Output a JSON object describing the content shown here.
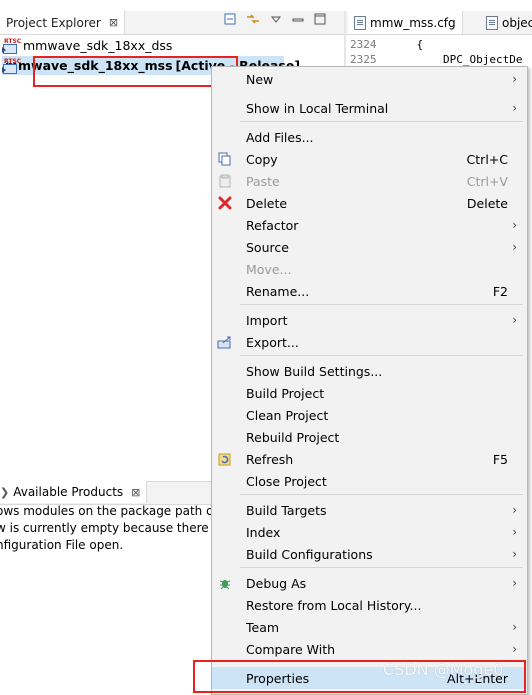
{
  "project_explorer": {
    "tab_title": "Project Explorer",
    "tree": [
      {
        "name": "mmwave_sdk_18xx_dss",
        "suffix": ""
      },
      {
        "name": "mmwave_sdk_18xx_mss",
        "suffix": "[Active - Release]"
      }
    ]
  },
  "editor": {
    "tabs": [
      "mmw_mss.cfg",
      "objec"
    ],
    "lines": [
      {
        "number": "2324",
        "text": "    {"
      },
      {
        "number": "2325",
        "text": "        DPC_ObjectDe"
      }
    ]
  },
  "available_products": {
    "tab_title": "Available Products",
    "text_lines": [
      "ows modules on the package path o",
      "w is currently empty because there is",
      "nfiguration File open."
    ]
  },
  "context_menu": {
    "groups": [
      [
        {
          "label": "New",
          "key": "",
          "submenu": true,
          "icon": "",
          "disabled": false
        },
        {
          "label": "Show in Local Terminal",
          "key": "",
          "submenu": true,
          "icon": "",
          "disabled": false
        }
      ],
      [
        {
          "label": "Add Files...",
          "key": "",
          "submenu": false,
          "icon": "",
          "disabled": false
        },
        {
          "label": "Copy",
          "key": "Ctrl+C",
          "submenu": false,
          "icon": "copy-icon",
          "disabled": false
        },
        {
          "label": "Paste",
          "key": "Ctrl+V",
          "submenu": false,
          "icon": "paste-icon",
          "disabled": true
        },
        {
          "label": "Delete",
          "key": "Delete",
          "submenu": false,
          "icon": "delete-icon",
          "disabled": false
        },
        {
          "label": "Refactor",
          "key": "",
          "submenu": true,
          "icon": "",
          "disabled": false
        },
        {
          "label": "Source",
          "key": "",
          "submenu": true,
          "icon": "",
          "disabled": false
        },
        {
          "label": "Move...",
          "key": "",
          "submenu": false,
          "icon": "",
          "disabled": true
        },
        {
          "label": "Rename...",
          "key": "F2",
          "submenu": false,
          "icon": "",
          "disabled": false
        }
      ],
      [
        {
          "label": "Import",
          "key": "",
          "submenu": true,
          "icon": "",
          "disabled": false
        },
        {
          "label": "Export...",
          "key": "",
          "submenu": false,
          "icon": "export-icon",
          "disabled": false
        }
      ],
      [
        {
          "label": "Show Build Settings...",
          "key": "",
          "submenu": false,
          "icon": "",
          "disabled": false
        },
        {
          "label": "Build Project",
          "key": "",
          "submenu": false,
          "icon": "",
          "disabled": false
        },
        {
          "label": "Clean Project",
          "key": "",
          "submenu": false,
          "icon": "",
          "disabled": false
        },
        {
          "label": "Rebuild Project",
          "key": "",
          "submenu": false,
          "icon": "",
          "disabled": false
        },
        {
          "label": "Refresh",
          "key": "F5",
          "submenu": false,
          "icon": "refresh-icon",
          "disabled": false
        },
        {
          "label": "Close Project",
          "key": "",
          "submenu": false,
          "icon": "",
          "disabled": false
        }
      ],
      [
        {
          "label": "Build Targets",
          "key": "",
          "submenu": true,
          "icon": "",
          "disabled": false
        },
        {
          "label": "Index",
          "key": "",
          "submenu": true,
          "icon": "",
          "disabled": false
        },
        {
          "label": "Build Configurations",
          "key": "",
          "submenu": true,
          "icon": "",
          "disabled": false
        }
      ],
      [
        {
          "label": "Debug As",
          "key": "",
          "submenu": true,
          "icon": "debug-icon",
          "disabled": false
        },
        {
          "label": "Restore from Local History...",
          "key": "",
          "submenu": false,
          "icon": "",
          "disabled": false
        },
        {
          "label": "Team",
          "key": "",
          "submenu": true,
          "icon": "",
          "disabled": false
        },
        {
          "label": "Compare With",
          "key": "",
          "submenu": true,
          "icon": "",
          "disabled": false
        }
      ],
      [
        {
          "label": "Properties",
          "key": "Alt+Enter",
          "submenu": false,
          "icon": "",
          "disabled": false,
          "highlighted": true
        }
      ]
    ]
  },
  "icons": {
    "close_glyph": "⊠",
    "submenu_glyph": "›"
  },
  "colors": {
    "selection": "#cde4f7",
    "annotation_box": "#e52323"
  },
  "watermark": "CSDN @Moge0"
}
